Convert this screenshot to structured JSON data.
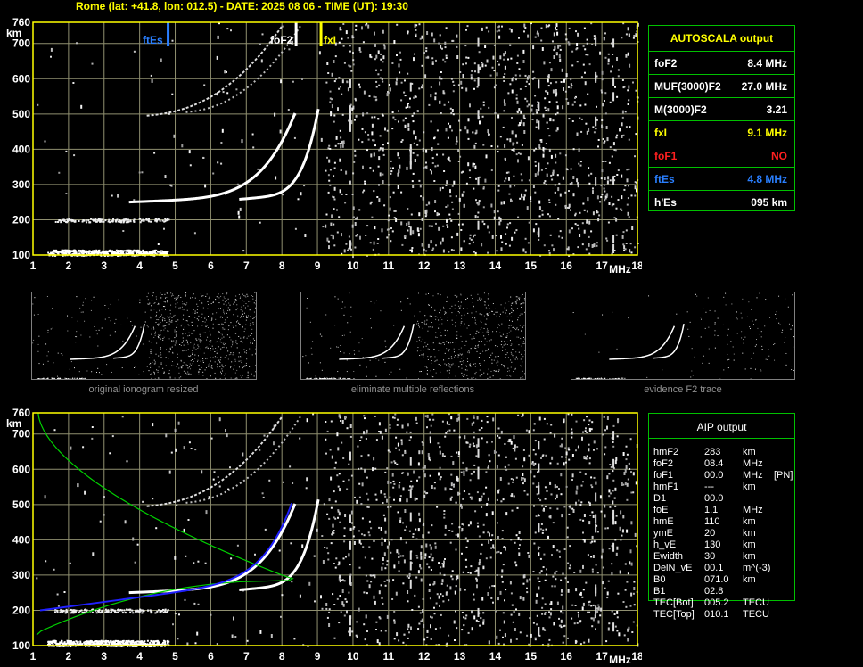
{
  "header": {
    "title": "Rome (lat: +41.8, lon: 012.5) - DATE: 2025 08 06 - TIME (UT): 19:30"
  },
  "axes": {
    "y_unit": "km",
    "x_unit": "MHz",
    "y_ticks": [
      "760",
      "700",
      "600",
      "500",
      "400",
      "300",
      "200",
      "100"
    ],
    "x_ticks": [
      "1",
      "2",
      "3",
      "4",
      "5",
      "6",
      "7",
      "8",
      "9",
      "10",
      "11",
      "12",
      "13",
      "14",
      "15",
      "16",
      "17",
      "18"
    ]
  },
  "markers": {
    "ftEs": {
      "label": "ftEs",
      "freq": 4.8,
      "color": "#2a7fff"
    },
    "foF2": {
      "label": "foF2",
      "freq": 8.4,
      "color": "#ffffff"
    },
    "fxI": {
      "label": "fxI",
      "freq": 9.1,
      "color": "#ffff00"
    }
  },
  "colors": {
    "grid": "#909070",
    "frame": "#ffff00",
    "trace": "#ffffff",
    "aip_profile": "#00d000",
    "aip_trace": "#2020ff"
  },
  "autoscala": {
    "title": "AUTOSCALA output",
    "rows": [
      {
        "key": "foF2",
        "value": "8.4 MHz",
        "color": "#ffffff"
      },
      {
        "key": "MUF(3000)F2",
        "value": "27.0 MHz",
        "color": "#ffffff"
      },
      {
        "key": "M(3000)F2",
        "value": "3.21",
        "color": "#ffffff"
      },
      {
        "key": "fxI",
        "value": "9.1 MHz",
        "color": "#ffff00"
      },
      {
        "key": "foF1",
        "value": "NO",
        "color": "#ff2020"
      },
      {
        "key": "ftEs",
        "value": "4.8 MHz",
        "color": "#2a7fff"
      },
      {
        "key": "h'Es",
        "value": "095     km",
        "color": "#ffffff"
      }
    ]
  },
  "thumbnails": [
    {
      "caption": "original ionogram resized"
    },
    {
      "caption": "eliminate multiple reflections"
    },
    {
      "caption": "evidence F2 trace"
    }
  ],
  "aip": {
    "title": "AIP output",
    "rows": [
      [
        "hmF2",
        "283",
        "km",
        ""
      ],
      [
        "foF2",
        "08.4",
        "MHz",
        ""
      ],
      [
        "foF1",
        "00.0",
        "MHz",
        "[PN]"
      ],
      [
        "hmF1",
        "---",
        "km",
        ""
      ],
      [
        "D1",
        "00.0",
        "",
        ""
      ],
      [
        "foE",
        "1.1",
        "MHz",
        ""
      ],
      [
        "hmE",
        "110",
        "km",
        ""
      ],
      [
        "ymE",
        "20",
        "km",
        ""
      ],
      [
        "h_vE",
        "130",
        "km",
        ""
      ],
      [
        "Ewidth",
        "30",
        "km",
        ""
      ],
      [
        "DelN_vE",
        "00.1",
        "m^(-3)",
        ""
      ],
      [
        "B0",
        "071.0",
        "km",
        ""
      ],
      [
        "B1",
        "02.8",
        "",
        ""
      ],
      [
        "TEC[Bot]",
        "005.2",
        "TECU",
        ""
      ],
      [
        "TEC[Top]",
        "010.1",
        "TECU",
        ""
      ]
    ]
  }
}
